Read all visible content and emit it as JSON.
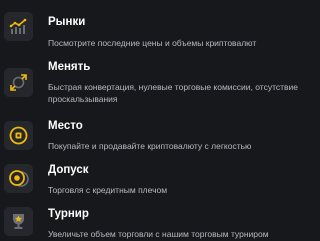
{
  "menu": {
    "items": [
      {
        "icon": "markets-chart-icon",
        "title": "Рынки",
        "description": "Посмотрите последние цены и объемы криптовалют"
      },
      {
        "icon": "convert-arrows-icon",
        "title": "Менять",
        "description": "Быстрая конвертация, нулевые торговые комиссии, отсутствие проскальзывания"
      },
      {
        "icon": "spot-coin-icon",
        "title": "Место",
        "description": "Покупайте и продавайте криптовалюту с легкостью"
      },
      {
        "icon": "margin-coin-icon",
        "title": "Допуск",
        "description": "Торговля с кредитным плечом"
      },
      {
        "icon": "tournament-trophy-icon",
        "title": "Турнир",
        "description": "Увеличьте объем торговли с нашим торговым турниром"
      }
    ]
  },
  "colors": {
    "background": "#17181c",
    "icon_tile": "#25272c",
    "accent": "#f0b90b",
    "title": "#ffffff",
    "description": "#b8bac0"
  }
}
